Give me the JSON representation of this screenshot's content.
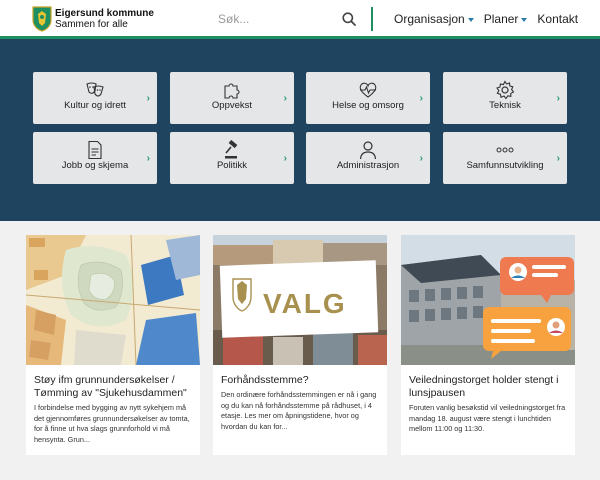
{
  "header": {
    "brand_name": "Eigersund kommune",
    "brand_tagline": "Sammen for alle",
    "search_placeholder": "Søk...",
    "nav": [
      {
        "label": "Organisasjon",
        "has_dropdown": true
      },
      {
        "label": "Planer",
        "has_dropdown": true
      },
      {
        "label": "Kontakt",
        "has_dropdown": false
      }
    ]
  },
  "colors": {
    "brand_green": "#1d8f63",
    "band_blue": "#1e4460",
    "tile_bg": "#e4e6e8"
  },
  "tiles": [
    {
      "label": "Kultur og idrett",
      "icon": "theater-masks-icon"
    },
    {
      "label": "Oppvekst",
      "icon": "puzzle-piece-icon"
    },
    {
      "label": "Helse og omsorg",
      "icon": "heartbeat-icon"
    },
    {
      "label": "Teknisk",
      "icon": "gear-icon"
    },
    {
      "label": "Jobb og skjema",
      "icon": "document-icon"
    },
    {
      "label": "Politikk",
      "icon": "gavel-icon"
    },
    {
      "label": "Administrasjon",
      "icon": "person-icon"
    },
    {
      "label": "Samfunnsutvikling",
      "icon": "ellipsis-icon"
    }
  ],
  "cards": [
    {
      "title": "Støy ifm grunnundersøkelser / Tømming av \"Sjukehusdammen\"",
      "body": "I forbindelse med bygging av nytt sykehjem må det gjennomføres grunnundersøkelser av tomta, for å finne ut hva slags grunnforhold vi må hensynta. Grun...",
      "image": "map-image"
    },
    {
      "title": "Forhåndsstemme?",
      "body": "Den ordinære forhåndsstemmingen er nå i gang og du kan nå forhåndsstemme på rådhuset, i 4 etasje. Les mer om åpningstidene, hvor og hvordan du kan for...",
      "image": "valg-image",
      "image_text": "VALG"
    },
    {
      "title": "Veiledningstorget holder stengt i lunsjpausen",
      "body": "Foruten vanlig besøkstid vil veiledningstorget fra mandag 18. august være stengt i lunchtiden mellom 11:00 og 11:30.",
      "image": "building-chat-image"
    }
  ]
}
